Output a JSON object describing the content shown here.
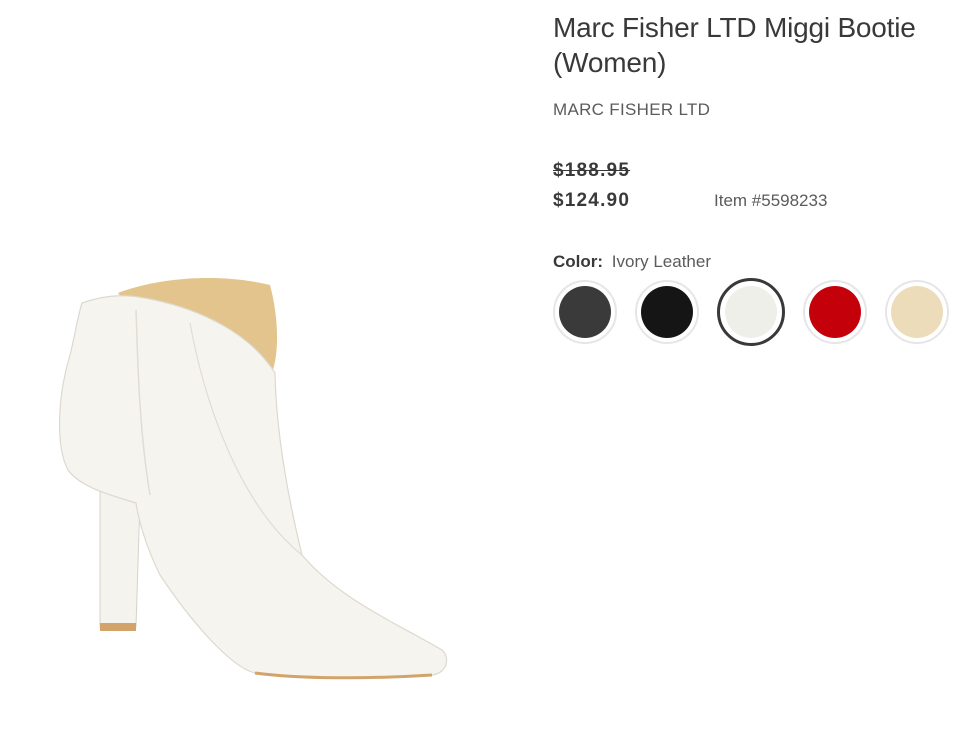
{
  "product": {
    "title": "Marc Fisher LTD Miggi Bootie (Women)",
    "brand": "MARC FISHER LTD",
    "original_price": "$188.95",
    "sale_price": "$124.90",
    "item_number": "Item #5598233"
  },
  "color": {
    "label": "Color:",
    "selected": "Ivory Leather",
    "swatches": [
      {
        "name": "dark-grey",
        "hex": "#3a3a3a"
      },
      {
        "name": "black",
        "hex": "#151515"
      },
      {
        "name": "ivory",
        "hex": "#efefe9",
        "selected": true
      },
      {
        "name": "red",
        "hex": "#c4000b"
      },
      {
        "name": "tan",
        "hex": "#ecdcba"
      }
    ]
  }
}
